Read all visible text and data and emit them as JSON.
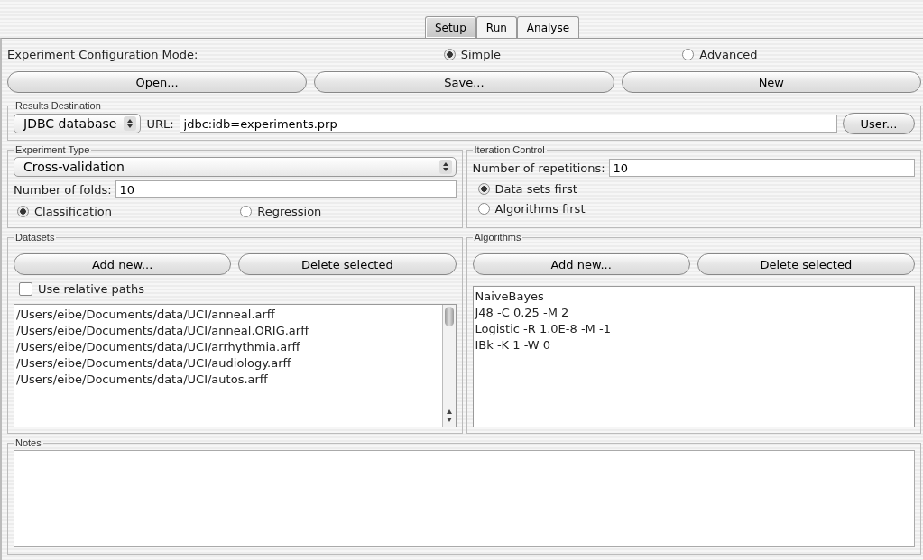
{
  "tabs": [
    {
      "label": "Setup",
      "selected": true
    },
    {
      "label": "Run",
      "selected": false
    },
    {
      "label": "Analyse",
      "selected": false
    }
  ],
  "mode": {
    "label": "Experiment Configuration Mode:",
    "options": [
      {
        "label": "Simple",
        "selected": true
      },
      {
        "label": "Advanced",
        "selected": false
      }
    ]
  },
  "file_buttons": [
    "Open...",
    "Save...",
    "New"
  ],
  "results_destination": {
    "title": "Results Destination",
    "type": "JDBC database",
    "url_label": "URL:",
    "url": "jdbc:idb=experiments.prp",
    "user_button": "User..."
  },
  "experiment_type": {
    "title": "Experiment Type",
    "type": "Cross-validation",
    "folds_label": "Number of folds:",
    "folds": "10",
    "options": [
      {
        "label": "Classification",
        "selected": true
      },
      {
        "label": "Regression",
        "selected": false
      }
    ]
  },
  "iteration_control": {
    "title": "Iteration Control",
    "repetitions_label": "Number of repetitions:",
    "repetitions": "10",
    "options": [
      {
        "label": "Data sets first",
        "selected": true
      },
      {
        "label": "Algorithms first",
        "selected": false
      }
    ]
  },
  "datasets": {
    "title": "Datasets",
    "buttons": [
      "Add new...",
      "Delete selected"
    ],
    "relative_paths": {
      "label": "Use relative paths",
      "checked": false
    },
    "items": [
      "/Users/eibe/Documents/data/UCI/anneal.arff",
      "/Users/eibe/Documents/data/UCI/anneal.ORIG.arff",
      "/Users/eibe/Documents/data/UCI/arrhythmia.arff",
      "/Users/eibe/Documents/data/UCI/audiology.arff",
      "/Users/eibe/Documents/data/UCI/autos.arff"
    ]
  },
  "algorithms": {
    "title": "Algorithms",
    "buttons": [
      "Add new...",
      "Delete selected"
    ],
    "items": [
      "NaiveBayes",
      "J48 -C 0.25 -M 2",
      "Logistic -R 1.0E-8 -M -1",
      "IBk -K 1 -W 0"
    ]
  },
  "notes": {
    "title": "Notes"
  }
}
